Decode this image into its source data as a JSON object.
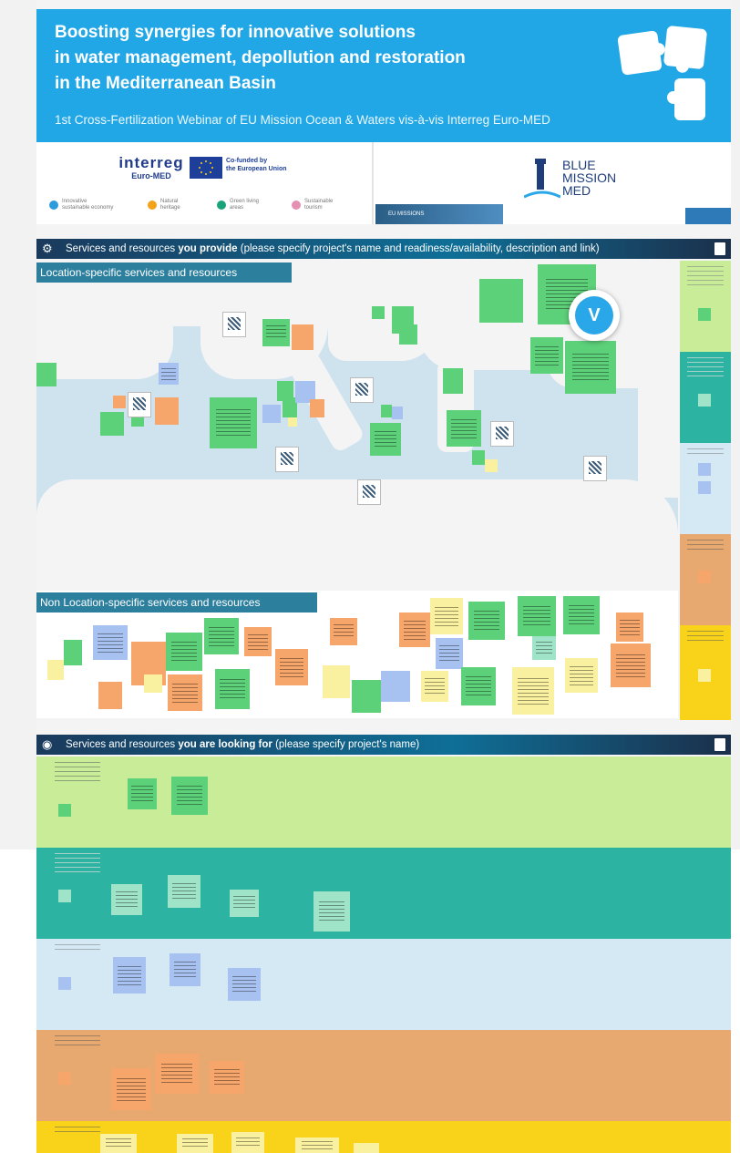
{
  "header": {
    "title": "Boosting synergies for innovative solutions\nin water management, depollution and restoration\nin the Mediterranean Basin",
    "subtitle": "1st Cross-Fertilization Webinar of EU Mission Ocean & Waters vis-à-vis Interreg Euro-MED"
  },
  "logos": {
    "interreg_name": "interreg",
    "interreg_sub": "Euro-MED",
    "eu_cofunded": "Co-funded by\nthe European Union",
    "bmm_name": "BLUE\nMISSION\nMED",
    "eu_missions": "EU MISSIONS",
    "legend": [
      {
        "label": "Innovative\nsustainable economy",
        "color": "#2d9bdc"
      },
      {
        "label": "Natural\nheritage",
        "color": "#f2a31a"
      },
      {
        "label": "Green living\nareas",
        "color": "#1aa37a"
      },
      {
        "label": "Sustainable\ntourism",
        "color": "#e58fb2"
      }
    ]
  },
  "provide_section": {
    "prefix": "Services  and resources ",
    "bold": "you provide",
    "suffix": " (please specify project's name and readiness/availability, description and link)",
    "location_label": "Location-specific services and resources",
    "nonlocation_label": "Non Location-specific services and resources"
  },
  "looking_section": {
    "prefix": "Services  and resources ",
    "bold": "you are looking for",
    "suffix": " (please specify project's name)"
  },
  "user": {
    "initial": "V"
  },
  "colors": {
    "green_row": "#c8ec98",
    "teal_row": "#2cb3a1",
    "lightblue_row": "#d5e9f5",
    "orange_row": "#e7a96f",
    "yellow_row": "#f9d21a"
  }
}
